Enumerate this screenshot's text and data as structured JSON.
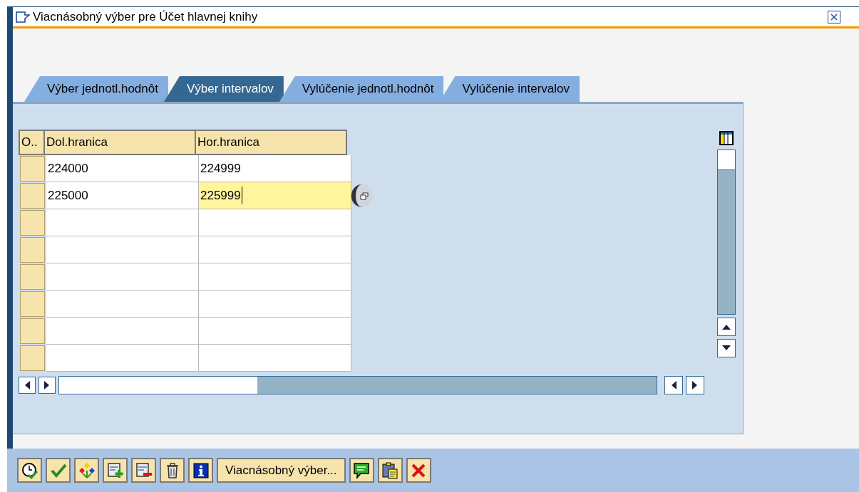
{
  "window": {
    "title": "Viacnásobný výber pre Účet hlavnej knihy"
  },
  "tabs": [
    {
      "label": "Výber jednotl.hodnôt",
      "selected": false
    },
    {
      "label": "Výber intervalov",
      "selected": true
    },
    {
      "label": "Vylúčenie jednotl.hodnôt",
      "selected": false
    },
    {
      "label": "Vylúčenie intervalov",
      "selected": false
    }
  ],
  "table": {
    "columns": [
      "O..",
      "Dol.hranica",
      "Hor.hranica"
    ],
    "rows": [
      {
        "cells": [
          "",
          "224000",
          "224999"
        ],
        "focused": false
      },
      {
        "cells": [
          "",
          "225000",
          "225999"
        ],
        "focused": true
      },
      {
        "cells": [
          "",
          "",
          ""
        ],
        "focused": false
      },
      {
        "cells": [
          "",
          "",
          ""
        ],
        "focused": false
      },
      {
        "cells": [
          "",
          "",
          ""
        ],
        "focused": false
      },
      {
        "cells": [
          "",
          "",
          ""
        ],
        "focused": false
      },
      {
        "cells": [
          "",
          "",
          ""
        ],
        "focused": false
      },
      {
        "cells": [
          "",
          "",
          ""
        ],
        "focused": false
      }
    ]
  },
  "toolbar": [
    {
      "kind": "clock"
    },
    {
      "kind": "check"
    },
    {
      "kind": "diamonds"
    },
    {
      "kind": "add"
    },
    {
      "kind": "remove"
    },
    {
      "kind": "trash"
    },
    {
      "kind": "info"
    },
    {
      "kind": "text",
      "label": "Viacnásobný výber..."
    },
    {
      "kind": "speech"
    },
    {
      "kind": "clipboard"
    },
    {
      "kind": "cancel"
    }
  ]
}
